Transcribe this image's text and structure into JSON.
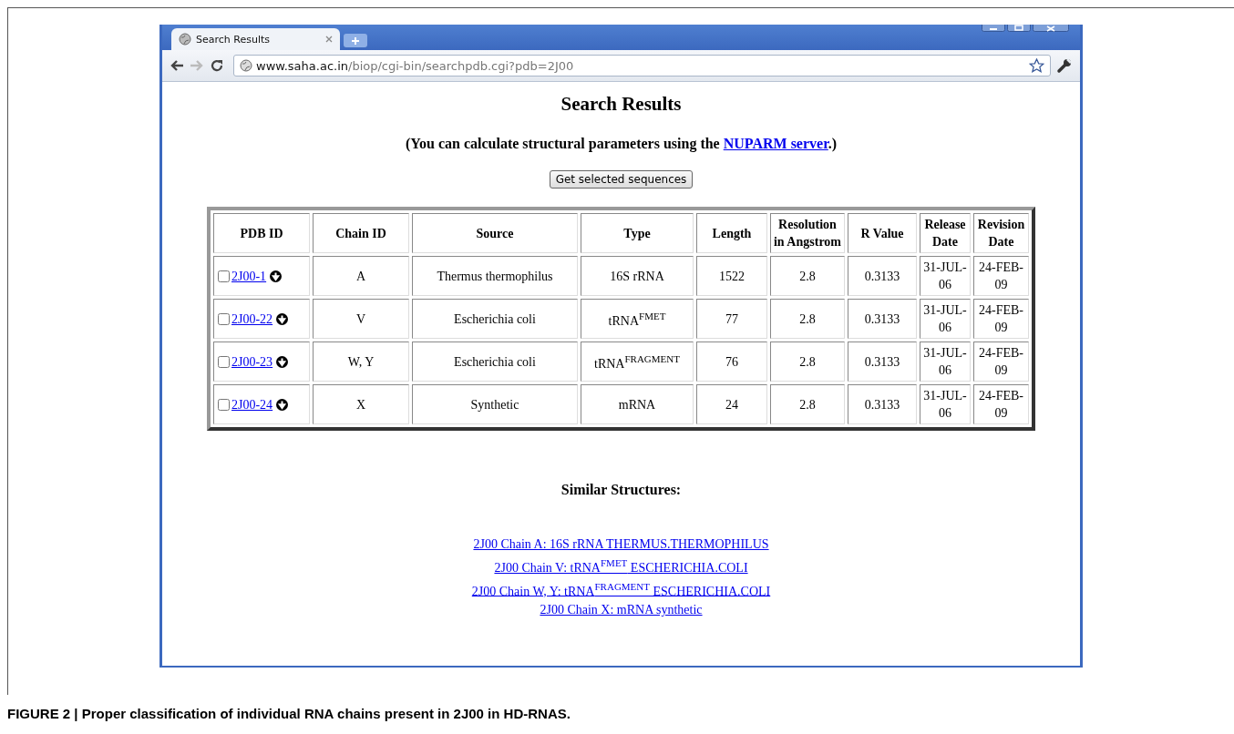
{
  "browser": {
    "tab": {
      "title": "Search Results",
      "selected": true
    },
    "url": {
      "host": "www.saha.ac.in",
      "path": "/biop/cgi-bin/searchpdb.cgi?pdb=2J00"
    }
  },
  "page": {
    "heading": "Search Results",
    "note": {
      "before": "(You can calculate structural parameters using the ",
      "link": "NUPARM server",
      "after": ".)"
    },
    "button": "Get selected sequences",
    "table": {
      "columns": [
        "PDB ID",
        "Chain ID",
        "Source",
        "Type",
        "Length",
        "Resolution in Angstrom",
        "R Value",
        "Release Date",
        "Revision Date"
      ],
      "rows": [
        {
          "checked": false,
          "pdb_id": "2J00-1",
          "chain_id": "A",
          "source": "Thermus thermophilus",
          "type": "16S rRNA",
          "length": "1522",
          "resolution": "2.8",
          "r_value": "0.3133",
          "release_date": "31-JUL-06",
          "revision_date": "24-FEB-09"
        },
        {
          "checked": false,
          "pdb_id": "2J00-22",
          "chain_id": "V",
          "source": "Escherichia coli",
          "type": "tRNA$^{FMET}$",
          "length": "77",
          "resolution": "2.8",
          "r_value": "0.3133",
          "release_date": "31-JUL-06",
          "revision_date": "24-FEB-09"
        },
        {
          "checked": false,
          "pdb_id": "2J00-23",
          "chain_id": "W, Y",
          "source": "Escherichia coli",
          "type": "tRNA$^{FRAGMENT}$",
          "length": "76",
          "resolution": "2.8",
          "r_value": "0.3133",
          "release_date": "31-JUL-06",
          "revision_date": "24-FEB-09"
        },
        {
          "checked": false,
          "pdb_id": "2J00-24",
          "chain_id": "X",
          "source": "Synthetic",
          "type": "mRNA",
          "length": "24",
          "resolution": "2.8",
          "r_value": "0.3133",
          "release_date": "31-JUL-06",
          "revision_date": "24-FEB-09"
        }
      ]
    },
    "similar_heading": "Similar Structures:",
    "similar_links": [
      "2J00 Chain A: 16S rRNA THERMUS.THERMOPHILUS",
      "2J00 Chain V: tRNA$^{FMET}$ ESCHERICHIA.COLI",
      "2J00 Chain W, Y: tRNA$^{FRAGMENT}$ ESCHERICHIA.COLI",
      "2J00 Chain X: mRNA synthetic"
    ]
  },
  "caption": "FIGURE 2 | Proper classification of individual RNA chains present in 2J00 in HD-RNAS."
}
